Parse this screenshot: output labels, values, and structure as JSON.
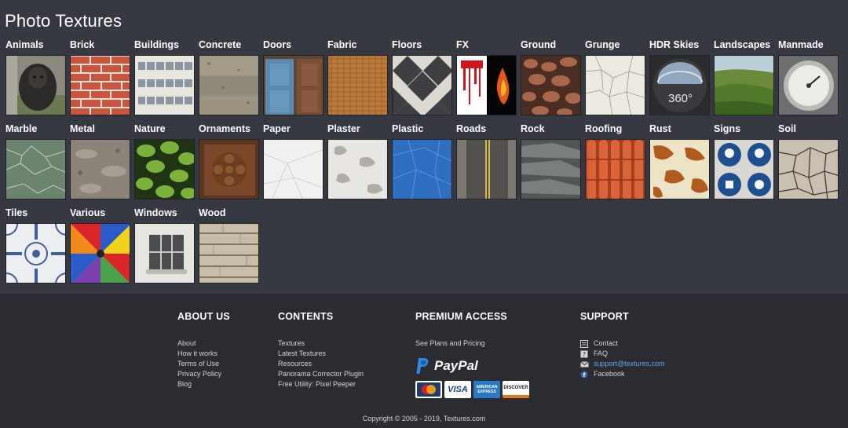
{
  "page": {
    "title": "Photo Textures"
  },
  "categories": [
    {
      "label": "Animals"
    },
    {
      "label": "Brick"
    },
    {
      "label": "Buildings"
    },
    {
      "label": "Concrete"
    },
    {
      "label": "Doors"
    },
    {
      "label": "Fabric"
    },
    {
      "label": "Floors"
    },
    {
      "label": "FX"
    },
    {
      "label": "Ground"
    },
    {
      "label": "Grunge"
    },
    {
      "label": "HDR Skies"
    },
    {
      "label": "Landscapes"
    },
    {
      "label": "Manmade"
    },
    {
      "label": "Marble"
    },
    {
      "label": "Metal"
    },
    {
      "label": "Nature"
    },
    {
      "label": "Ornaments"
    },
    {
      "label": "Paper"
    },
    {
      "label": "Plaster"
    },
    {
      "label": "Plastic"
    },
    {
      "label": "Roads"
    },
    {
      "label": "Rock"
    },
    {
      "label": "Roofing"
    },
    {
      "label": "Rust"
    },
    {
      "label": "Signs"
    },
    {
      "label": "Soil"
    },
    {
      "label": "Tiles"
    },
    {
      "label": "Various"
    },
    {
      "label": "Windows"
    },
    {
      "label": "Wood"
    }
  ],
  "hdr_badge": "360°",
  "footer": {
    "about": {
      "heading": "ABOUT US",
      "links": [
        "About",
        "How it works",
        "Terms of Use",
        "Privacy Policy",
        "Blog"
      ]
    },
    "contents": {
      "heading": "CONTENTS",
      "links": [
        "Textures",
        "Latest Textures",
        "Resources",
        "Panorama Corrector Plugin",
        "Free Utility: Pixel Peeper"
      ]
    },
    "premium": {
      "heading": "PREMIUM ACCESS",
      "plans_link": "See Plans and Pricing",
      "paypal": "PayPal",
      "cards": [
        "MasterCard",
        "VISA",
        "AMERICAN EXPRESS",
        "DISCOVER"
      ]
    },
    "support": {
      "heading": "SUPPORT",
      "contact": "Contact",
      "faq": "FAQ",
      "email": "support@textures.com",
      "facebook": "Facebook"
    },
    "copyright": "Copyright © 2005 - 2019, Textures.com"
  }
}
